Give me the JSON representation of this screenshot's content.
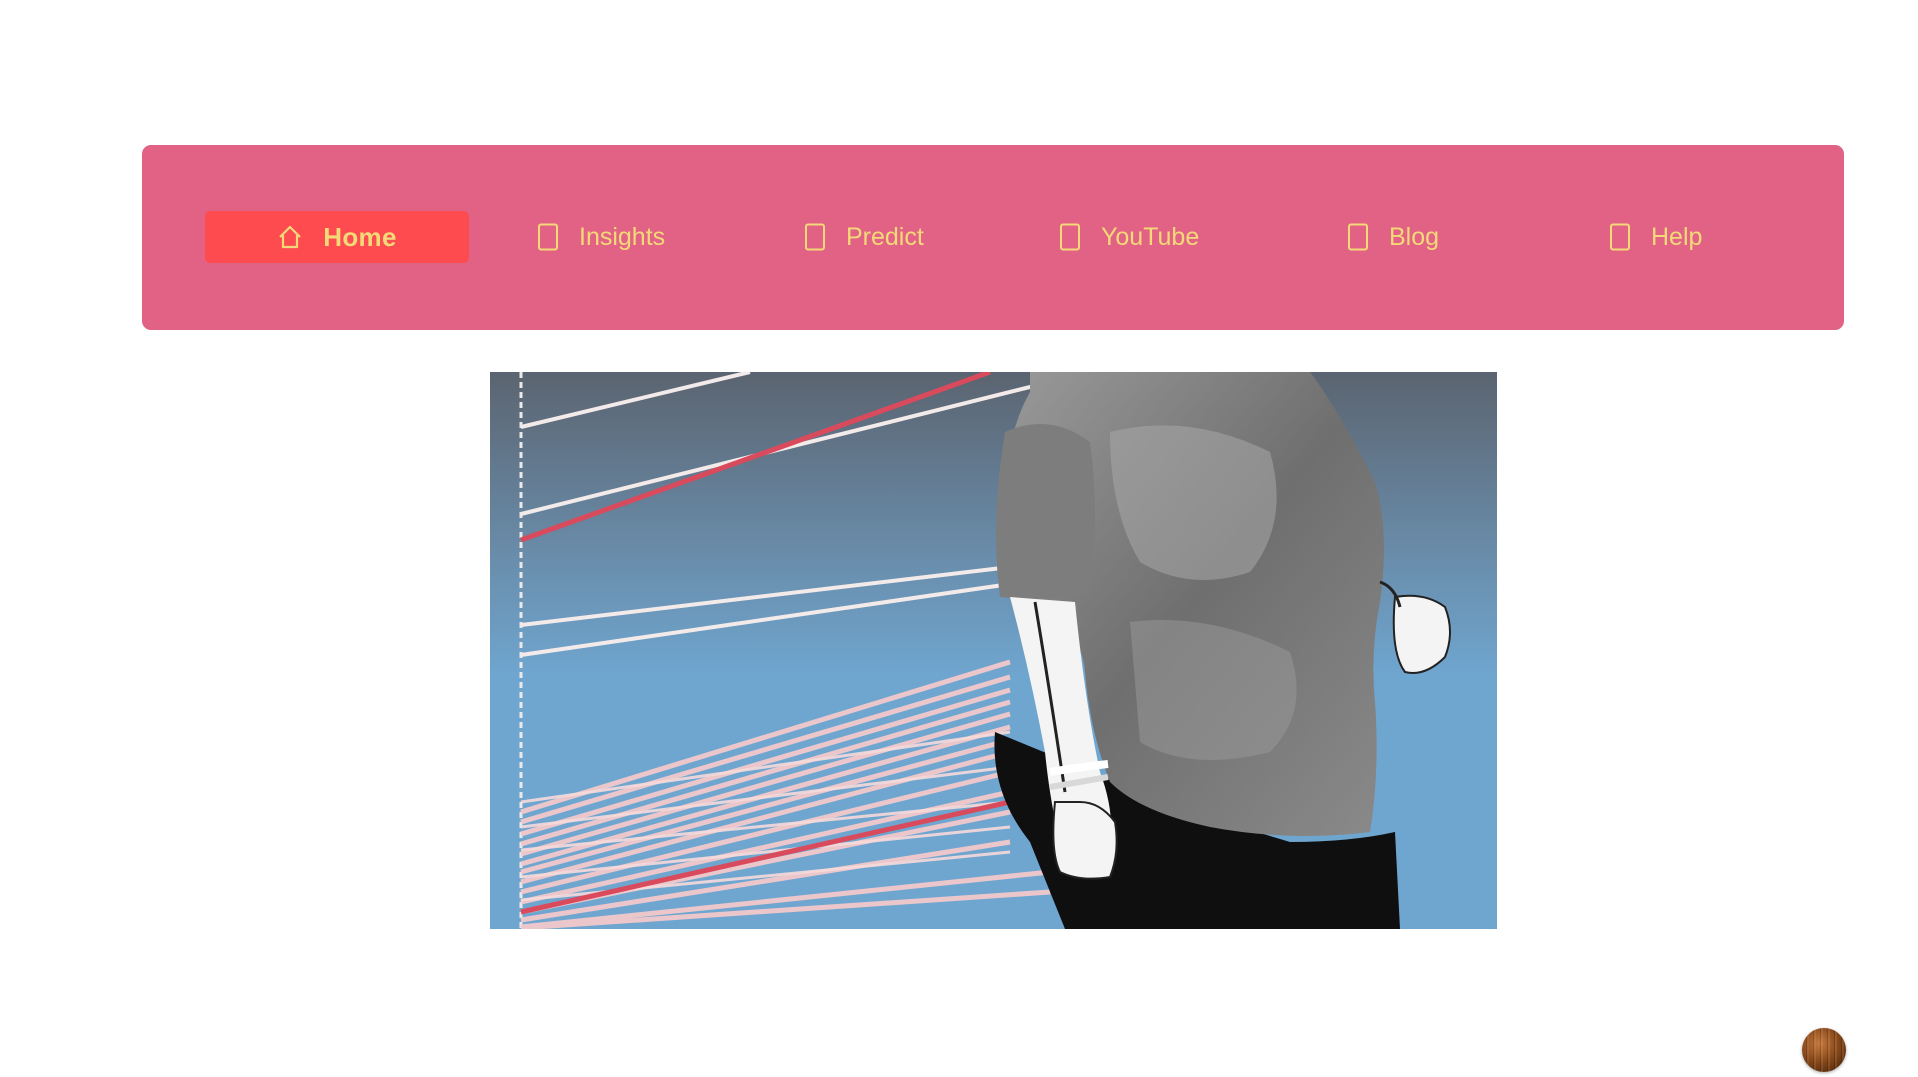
{
  "nav": {
    "items": [
      {
        "label": "Home",
        "icon": "home-icon",
        "active": true
      },
      {
        "label": "Insights",
        "icon": "insights-icon",
        "active": false
      },
      {
        "label": "Predict",
        "icon": "predict-icon",
        "active": false
      },
      {
        "label": "YouTube",
        "icon": "youtube-icon",
        "active": false
      },
      {
        "label": "Blog",
        "icon": "blog-icon",
        "active": false
      },
      {
        "label": "Help",
        "icon": "help-icon",
        "active": false
      }
    ]
  },
  "hero": {
    "image": "person-jogging-with-line-chart-graphic"
  },
  "colors": {
    "navbar_bg": "#e26285",
    "active_bg": "#fd4b4f",
    "nav_text": "#f3d978",
    "hero_sky": "#6fa6d0"
  },
  "chat_widget": {
    "icon": "chat-avatar-icon"
  }
}
